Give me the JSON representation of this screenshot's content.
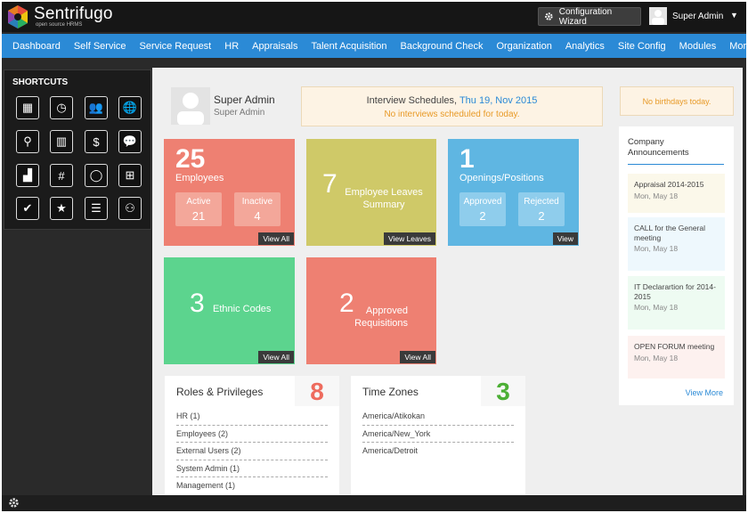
{
  "brand": {
    "name": "Sentrifugo",
    "tagline": "open source HRMS"
  },
  "header": {
    "config_label": "Configuration Wizard",
    "user_name": "Super Admin",
    "caret": "▼",
    "config_icon": "gear-icon"
  },
  "nav": {
    "items": [
      "Dashboard",
      "Self Service",
      "Service Request",
      "HR",
      "Appraisals",
      "Talent Acquisition",
      "Background Check",
      "Organization",
      "Analytics",
      "Site Config",
      "Modules",
      "More ▾"
    ]
  },
  "shortcuts": {
    "title": "SHORTCUTS",
    "icons": [
      "boxes-icon",
      "clock-icon",
      "users-icon",
      "globe-pin-icon",
      "location-pins-icon",
      "building-icon",
      "money-icon",
      "chat-icon",
      "stairs-icon",
      "calculator-icon",
      "circle-icon",
      "org-chart-icon",
      "user-check-icon",
      "user-star-icon",
      "user-list-icon",
      "group-icon"
    ],
    "glyphs": [
      "▦",
      "◷",
      "👥",
      "🌐",
      "⚲",
      "▥",
      "$",
      "💬",
      "▟",
      "#",
      "◯",
      "⊞",
      "✔",
      "★",
      "☰",
      "⚇"
    ]
  },
  "profile": {
    "name": "Super Admin",
    "role": "Super Admin"
  },
  "interview": {
    "title": "Interview Schedules,",
    "date": "Thu 19, Nov 2015",
    "note": "No interviews scheduled for today."
  },
  "birthday": {
    "note": "No birthdays today."
  },
  "cards": {
    "employees": {
      "count": "25",
      "label": "Employees",
      "active_label": "Active",
      "active": "21",
      "inactive_label": "Inactive",
      "inactive": "4",
      "button": "View All"
    },
    "leaves": {
      "count": "7",
      "label": "Employee Leaves Summary",
      "button": "View Leaves"
    },
    "openings": {
      "count": "1",
      "label": "Openings/Positions",
      "approved_label": "Approved",
      "approved": "2",
      "rejected_label": "Rejected",
      "rejected": "2",
      "button": "View"
    },
    "ethnic": {
      "count": "3",
      "label": "Ethnic Codes",
      "button": "View All"
    },
    "requisitions": {
      "count": "2",
      "label": "Approved Requisitions",
      "button": "View All"
    }
  },
  "roles": {
    "title": "Roles & Privileges",
    "count": "8",
    "color": "#ee6b5d",
    "items": [
      "HR (1)",
      "Employees (2)",
      "External Users (2)",
      "System Admin (1)",
      "Management (1)"
    ]
  },
  "timezones": {
    "title": "Time Zones",
    "count": "3",
    "color": "#4caf35",
    "items": [
      "America/Atikokan",
      "America/New_York",
      "America/Detroit"
    ]
  },
  "announcements": {
    "title": "Company Announcements",
    "items": [
      {
        "title": "Appraisal 2014-2015",
        "date": "Mon, May 18",
        "bg": "#fbf8ea"
      },
      {
        "title": "CALL for the General meeting",
        "date": "Mon, May 18",
        "bg": "#eef8fd"
      },
      {
        "title": "IT Declarartion for 2014-2015",
        "date": "Mon, May 18",
        "bg": "#eefbf2"
      },
      {
        "title": "OPEN FORUM meeting",
        "date": "Mon, May 18",
        "bg": "#fdf1ef"
      }
    ],
    "more": "View More"
  },
  "footer": {
    "settings_icon": "gear-icon"
  }
}
